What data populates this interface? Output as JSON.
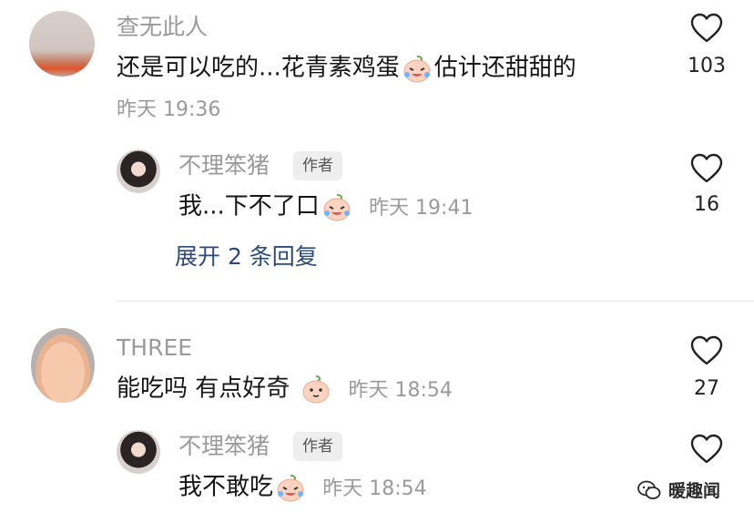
{
  "comments": [
    {
      "user": "查无此人",
      "text_before": "还是可以吃的...花青素鸡蛋",
      "text_after": "估计还甜甜的",
      "time": "昨天 19:36",
      "likes": "103",
      "emoji_icon": "crying-laughing-bun-emoji"
    },
    {
      "user": "THREE",
      "text_before": "能吃吗 有点好奇",
      "time": "昨天 18:54",
      "likes": "27",
      "emoji_icon": "peach-bun-emoji"
    }
  ],
  "replies": [
    {
      "user": "不理笨猪",
      "author_tag": "作者",
      "text_before": "我...下不了口",
      "time": "昨天 19:41",
      "likes": "16"
    },
    {
      "user": "不理笨猪",
      "author_tag": "作者",
      "text_before": "我不敢吃",
      "time": "昨天 18:54"
    }
  ],
  "expand_label": "展开 2 条回复",
  "watermark": "暖趣闻",
  "colors": {
    "link": "#2b4a7d",
    "meta": "#9a9a9a",
    "text": "#161616"
  }
}
